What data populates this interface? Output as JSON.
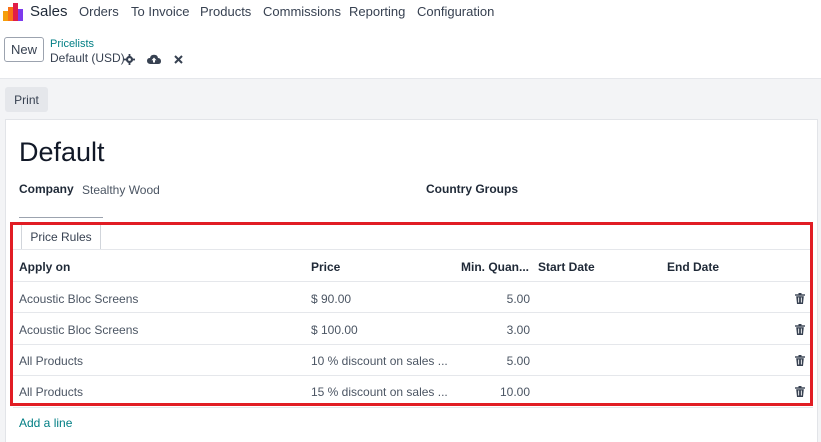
{
  "navbar": {
    "app_name": "Sales",
    "menu": [
      "Orders",
      "To Invoice",
      "Products",
      "Commissions",
      "Reporting",
      "Configuration"
    ]
  },
  "control_panel": {
    "new_label": "New",
    "breadcrumb": "Pricelists",
    "record_name": "Default (USD)"
  },
  "print_label": "Print",
  "form": {
    "title": "Default",
    "company_label": "Company",
    "company_value": "Stealthy Wood",
    "country_groups_label": "Country Groups",
    "tab_label": "Price Rules",
    "columns": [
      "Apply on",
      "Price",
      "Min. Quan...",
      "Start Date",
      "End Date"
    ],
    "rows": [
      {
        "apply_on": "Acoustic Bloc Screens",
        "price": "$ 90.00",
        "min_qty": "5.00",
        "start": "",
        "end": ""
      },
      {
        "apply_on": "Acoustic Bloc Screens",
        "price": "$ 100.00",
        "min_qty": "3.00",
        "start": "",
        "end": ""
      },
      {
        "apply_on": "All Products",
        "price": "10 % discount on sales ...",
        "min_qty": "5.00",
        "start": "",
        "end": ""
      },
      {
        "apply_on": "All Products",
        "price": "15 % discount on sales ...",
        "min_qty": "10.00",
        "start": "",
        "end": ""
      }
    ],
    "add_line_label": "Add a line"
  },
  "colors": {
    "accent": "#017e84",
    "highlight": "#e11d24"
  }
}
